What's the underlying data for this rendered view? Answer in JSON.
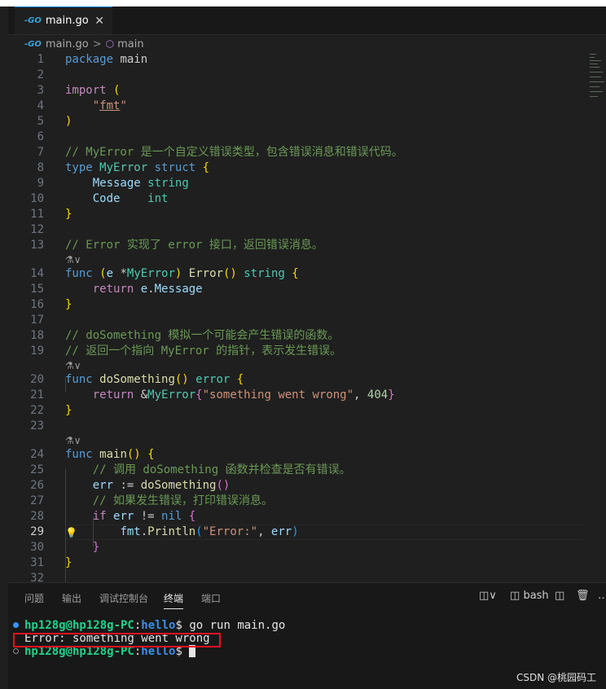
{
  "tab": {
    "icon": "go-file-icon",
    "icon_text": "-GO",
    "label": "main.go",
    "close": "✕"
  },
  "breadcrumb": {
    "file": "main.go",
    "separator": ">",
    "symbol": "main"
  },
  "codelens": "⚗∨",
  "code_lines": [
    {
      "n": "1",
      "tokens": [
        [
          "kw",
          "package"
        ],
        [
          "pl",
          " main"
        ]
      ]
    },
    {
      "n": "2",
      "tokens": []
    },
    {
      "n": "3",
      "tokens": [
        [
          "kw2",
          "import"
        ],
        [
          "pl",
          " "
        ],
        [
          "b1",
          "("
        ]
      ]
    },
    {
      "n": "4",
      "tokens": [
        [
          "pl",
          "    "
        ],
        [
          "str",
          "\""
        ],
        [
          "str ul",
          "fmt"
        ],
        [
          "str",
          "\""
        ]
      ]
    },
    {
      "n": "5",
      "tokens": [
        [
          "b1",
          ")"
        ]
      ]
    },
    {
      "n": "6",
      "tokens": []
    },
    {
      "n": "7",
      "tokens": [
        [
          "cmt",
          "// MyError 是一个自定义错误类型，包含错误消息和错误代码。"
        ]
      ]
    },
    {
      "n": "8",
      "tokens": [
        [
          "kw",
          "type"
        ],
        [
          "pl",
          " "
        ],
        [
          "ty",
          "MyError"
        ],
        [
          "pl",
          " "
        ],
        [
          "kw",
          "struct"
        ],
        [
          "pl",
          " "
        ],
        [
          "b1",
          "{"
        ]
      ]
    },
    {
      "n": "9",
      "tokens": [
        [
          "pl",
          "    "
        ],
        [
          "var",
          "Message"
        ],
        [
          "pl",
          " "
        ],
        [
          "ty",
          "string"
        ]
      ]
    },
    {
      "n": "10",
      "tokens": [
        [
          "pl",
          "    "
        ],
        [
          "var",
          "Code"
        ],
        [
          "pl",
          "    "
        ],
        [
          "ty",
          "int"
        ]
      ]
    },
    {
      "n": "11",
      "tokens": [
        [
          "b1",
          "}"
        ]
      ]
    },
    {
      "n": "12",
      "tokens": []
    },
    {
      "n": "13",
      "tokens": [
        [
          "cmt",
          "// Error 实现了 error 接口，返回错误消息。"
        ]
      ],
      "lens_after": true
    },
    {
      "n": "14",
      "tokens": [
        [
          "kw",
          "func"
        ],
        [
          "pl",
          " "
        ],
        [
          "b1",
          "("
        ],
        [
          "var",
          "e"
        ],
        [
          "pl",
          " *"
        ],
        [
          "ty",
          "MyError"
        ],
        [
          "b1",
          ")"
        ],
        [
          "pl",
          " "
        ],
        [
          "fn",
          "Error"
        ],
        [
          "b1",
          "()"
        ],
        [
          "pl",
          " "
        ],
        [
          "ty",
          "string"
        ],
        [
          "pl",
          " "
        ],
        [
          "b1",
          "{"
        ]
      ]
    },
    {
      "n": "15",
      "tokens": [
        [
          "pl",
          "    "
        ],
        [
          "kw2",
          "return"
        ],
        [
          "pl",
          " "
        ],
        [
          "var",
          "e"
        ],
        [
          "pl",
          "."
        ],
        [
          "var",
          "Message"
        ]
      ]
    },
    {
      "n": "16",
      "tokens": [
        [
          "b1",
          "}"
        ]
      ]
    },
    {
      "n": "17",
      "tokens": []
    },
    {
      "n": "18",
      "tokens": [
        [
          "cmt",
          "// doSomething 模拟一个可能会产生错误的函数。"
        ]
      ]
    },
    {
      "n": "19",
      "tokens": [
        [
          "cmt",
          "// 返回一个指向 MyError 的指针，表示发生错误。"
        ]
      ],
      "lens_after": true
    },
    {
      "n": "20",
      "tokens": [
        [
          "kw",
          "func"
        ],
        [
          "pl",
          " "
        ],
        [
          "fn",
          "doSomething"
        ],
        [
          "b1",
          "()"
        ],
        [
          "pl",
          " "
        ],
        [
          "ty",
          "error"
        ],
        [
          "pl",
          " "
        ],
        [
          "b1",
          "{"
        ]
      ]
    },
    {
      "n": "21",
      "tokens": [
        [
          "pl",
          "    "
        ],
        [
          "kw2",
          "return"
        ],
        [
          "pl",
          " &"
        ],
        [
          "ty",
          "MyError"
        ],
        [
          "b2",
          "{"
        ],
        [
          "str",
          "\"something went wrong\""
        ],
        [
          "pl",
          ", "
        ],
        [
          "num",
          "404"
        ],
        [
          "b2",
          "}"
        ]
      ]
    },
    {
      "n": "22",
      "tokens": [
        [
          "b1",
          "}"
        ]
      ]
    },
    {
      "n": "23",
      "tokens": [],
      "lens_after": true
    },
    {
      "n": "24",
      "tokens": [
        [
          "kw",
          "func"
        ],
        [
          "pl",
          " "
        ],
        [
          "fn",
          "main"
        ],
        [
          "b1",
          "()"
        ],
        [
          "pl",
          " "
        ],
        [
          "b1",
          "{"
        ]
      ]
    },
    {
      "n": "25",
      "tokens": [
        [
          "pl",
          "    "
        ],
        [
          "cmt",
          "// 调用 doSomething 函数并检查是否有错误。"
        ]
      ]
    },
    {
      "n": "26",
      "tokens": [
        [
          "pl",
          "    "
        ],
        [
          "var",
          "err"
        ],
        [
          "pl",
          " := "
        ],
        [
          "fn",
          "doSomething"
        ],
        [
          "b2",
          "()"
        ]
      ]
    },
    {
      "n": "27",
      "tokens": [
        [
          "pl",
          "    "
        ],
        [
          "cmt",
          "// 如果发生错误，打印错误消息。"
        ]
      ]
    },
    {
      "n": "28",
      "tokens": [
        [
          "pl",
          "    "
        ],
        [
          "kw2",
          "if"
        ],
        [
          "pl",
          " "
        ],
        [
          "var",
          "err"
        ],
        [
          "pl",
          " != "
        ],
        [
          "kw",
          "nil"
        ],
        [
          "pl",
          " "
        ],
        [
          "b2",
          "{"
        ]
      ]
    },
    {
      "n": "29",
      "tokens": [
        [
          "pl",
          "        "
        ],
        [
          "var",
          "fmt"
        ],
        [
          "pl",
          "."
        ],
        [
          "fn",
          "Println"
        ],
        [
          "b3",
          "("
        ],
        [
          "str",
          "\"Error:\""
        ],
        [
          "pl",
          ", "
        ],
        [
          "var",
          "err"
        ],
        [
          "b3",
          ")"
        ]
      ],
      "active": true
    },
    {
      "n": "30",
      "tokens": [
        [
          "pl",
          "    "
        ],
        [
          "b2",
          "}"
        ]
      ]
    },
    {
      "n": "31",
      "tokens": [
        [
          "b1",
          "}"
        ]
      ]
    },
    {
      "n": "32",
      "tokens": []
    }
  ],
  "panel": {
    "tabs": [
      "问题",
      "输出",
      "调试控制台",
      "终端",
      "端口"
    ],
    "active_tab": "终端",
    "shell": "bash"
  },
  "terminal": {
    "lines": [
      {
        "dot": "filled",
        "user": "hp128g@hp128g-PC",
        "colon": ":",
        "dir": "hello",
        "prompt": "$ ",
        "cmd": "go run main.go"
      },
      {
        "dot": "none",
        "output": "Error: something went wrong"
      },
      {
        "dot": "hollow",
        "user": "hp128g@hp128g-PC",
        "colon": ":",
        "dir": "hello",
        "prompt": "$ ",
        "cursor": true
      }
    ]
  },
  "watermark": "CSDN @桃园码工",
  "colors": {
    "accent": "#0078d4",
    "highlight_box": "#e81123",
    "terminal_green": "#23d18b",
    "terminal_blue": "#3b8eea"
  }
}
